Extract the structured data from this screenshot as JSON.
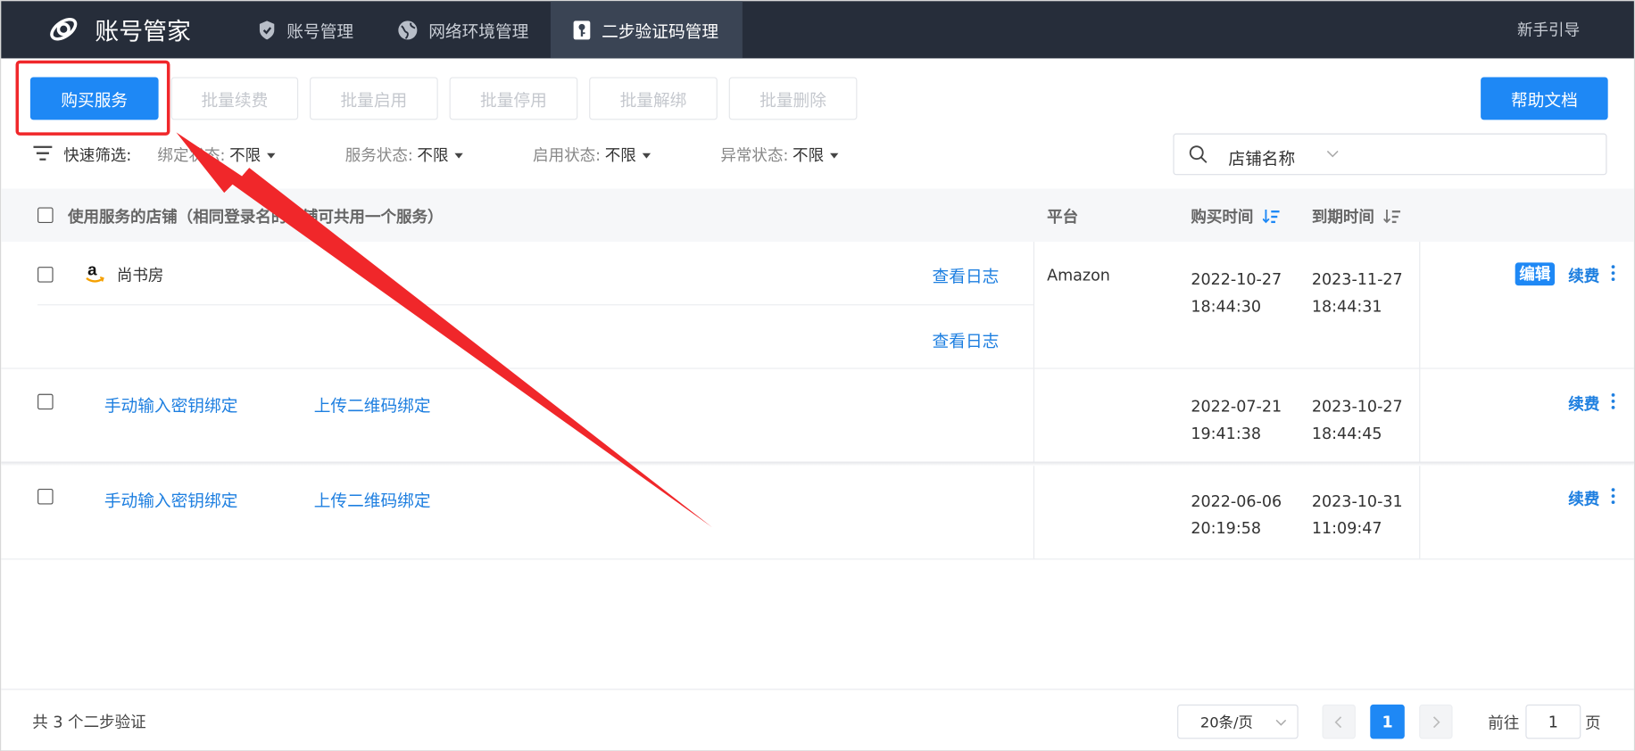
{
  "nav": {
    "app_name": "账号管家",
    "tabs": [
      {
        "label": "账号管理",
        "icon": "shield-icon"
      },
      {
        "label": "网络环境管理",
        "icon": "globe-icon"
      },
      {
        "label": "二步验证码管理",
        "icon": "key-lock-icon",
        "active": true
      }
    ],
    "guide": "新手引导"
  },
  "toolbar": {
    "buy": "购买服务",
    "batch_renew": "批量续费",
    "batch_enable": "批量启用",
    "batch_disable": "批量停用",
    "batch_unbind": "批量解绑",
    "batch_delete": "批量删除",
    "help": "帮助文档"
  },
  "filters": {
    "label": "快速筛选:",
    "items": [
      {
        "label": "绑定状态:",
        "value": "不限"
      },
      {
        "label": "服务状态:",
        "value": "不限"
      },
      {
        "label": "启用状态:",
        "value": "不限"
      },
      {
        "label": "异常状态:",
        "value": "不限"
      }
    ],
    "search_placeholder": "店铺名称"
  },
  "table": {
    "headers": {
      "shop": "使用服务的店铺（相同登录名的店铺可共用一个服务）",
      "platform": "平台",
      "buy_time": "购买时间",
      "expire_time": "到期时间"
    },
    "rows": [
      {
        "shop": "尚书房",
        "log1": "查看日志",
        "log2": "查看日志",
        "platform": "Amazon",
        "buy_date": "2022-10-27",
        "buy_clock": "18:44:30",
        "exp_date": "2023-11-27",
        "exp_clock": "18:44:31",
        "edit": "编辑",
        "renew": "续费"
      },
      {
        "bind_manual": "手动输入密钥绑定",
        "bind_qr": "上传二维码绑定",
        "buy_date": "2022-07-21",
        "buy_clock": "19:41:38",
        "exp_date": "2023-10-27",
        "exp_clock": "18:44:45",
        "renew": "续费"
      },
      {
        "bind_manual": "手动输入密钥绑定",
        "bind_qr": "上传二维码绑定",
        "buy_date": "2022-06-06",
        "buy_clock": "20:19:58",
        "exp_date": "2023-10-31",
        "exp_clock": "11:09:47",
        "renew": "续费"
      }
    ]
  },
  "footer": {
    "total": "共 3 个二步验证",
    "page_size": "20条/页",
    "current_page": "1",
    "goto_label": "前往",
    "goto_value": "1",
    "page_unit": "页"
  },
  "colors": {
    "primary": "#1e88f5",
    "nav_bg": "#262d3a",
    "annotation_red": "#f0272a"
  }
}
